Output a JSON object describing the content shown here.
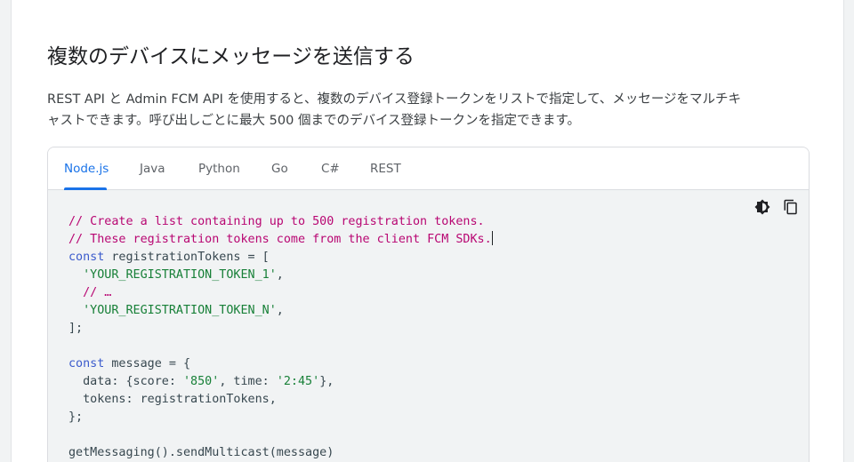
{
  "section": {
    "title": "複数のデバイスにメッセージを送信する",
    "description_line1": "REST API と Admin FCM API を使用すると、複数のデバイス登録トークンをリストで指定して、メッセージをマルチキ",
    "description_line2": "ャストできます。呼び出しごとに最大 500 個までのデバイス登録トークンを指定できます。"
  },
  "tabs": [
    {
      "label": "Node.js",
      "active": true
    },
    {
      "label": "Java",
      "active": false
    },
    {
      "label": "Python",
      "active": false
    },
    {
      "label": "Go",
      "active": false
    },
    {
      "label": "C#",
      "active": false
    },
    {
      "label": "REST",
      "active": false
    }
  ],
  "toolbar": {
    "theme_icon": "brightness-icon",
    "copy_icon": "copy-icon"
  },
  "code": {
    "l1": "// Create a list containing up to 500 registration tokens.",
    "l2": "// These registration tokens come from the client FCM SDKs.",
    "l3_kw": "const",
    "l3_rest": " registrationTokens = [",
    "l4_str": "'YOUR_REGISTRATION_TOKEN_1'",
    "l4_rest": ",",
    "l5": "// …",
    "l6_str": "'YOUR_REGISTRATION_TOKEN_N'",
    "l6_rest": ",",
    "l7": "];",
    "l9_kw": "const",
    "l9_rest": " message = {",
    "l10_a": "data: {score: ",
    "l10_s1": "'850'",
    "l10_b": ", time: ",
    "l10_s2": "'2:45'",
    "l10_c": "},",
    "l11": "tokens: registrationTokens,",
    "l12": "};",
    "l14": "getMessaging().sendMulticast(message)"
  },
  "colors": {
    "accent": "#1a73e8",
    "comment": "#b80672",
    "keyword": "#3b5bcc",
    "string": "#188038"
  }
}
